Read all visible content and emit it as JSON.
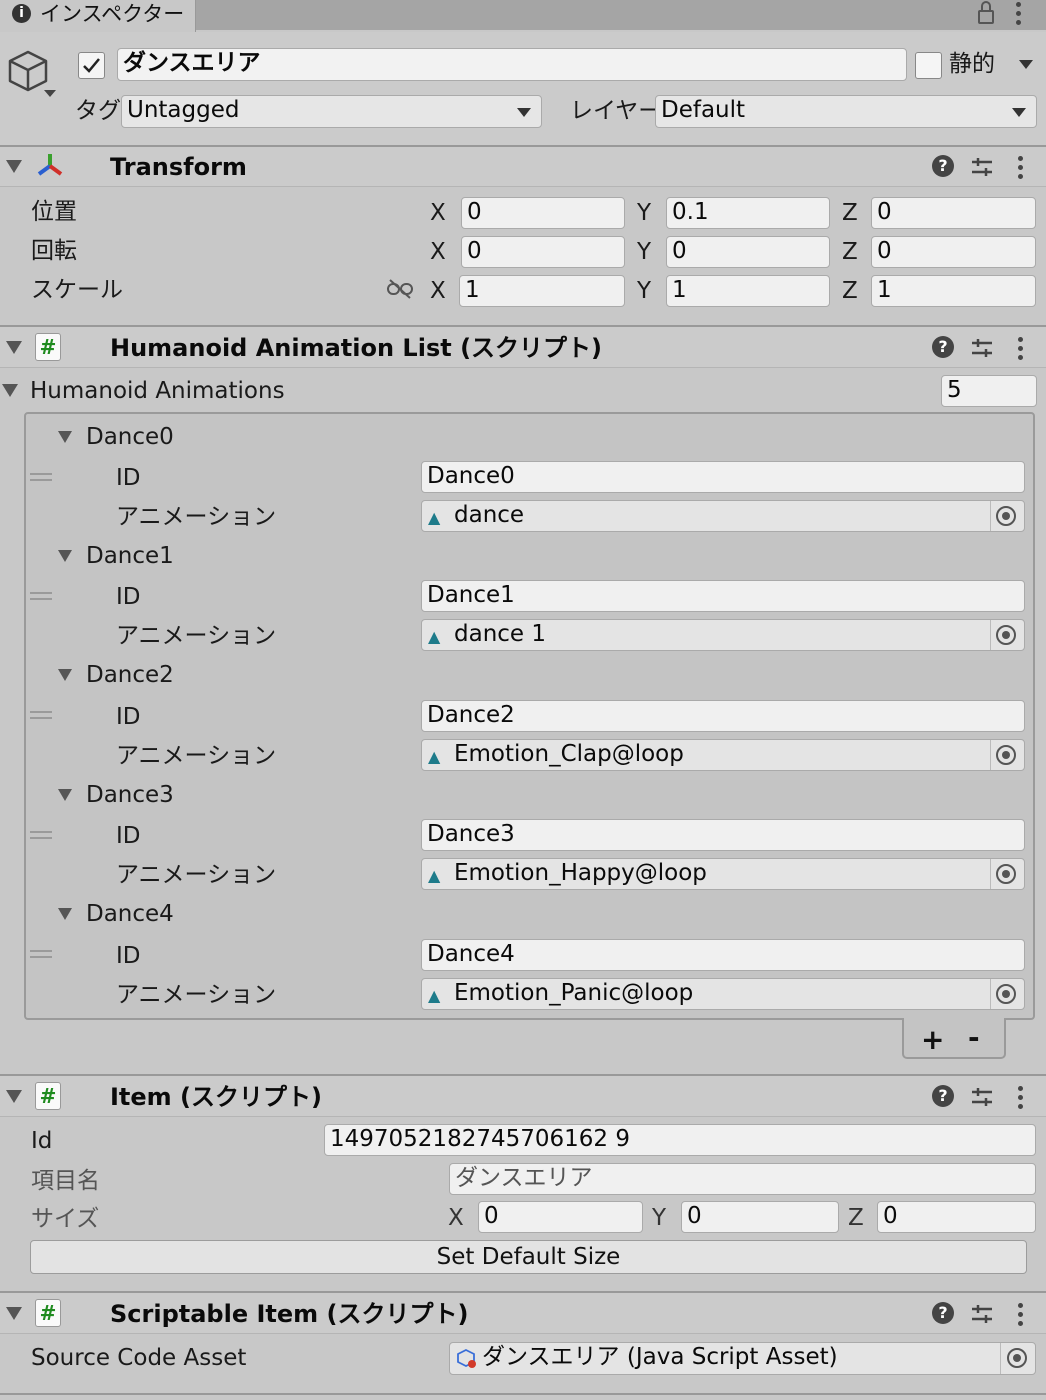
{
  "tab": {
    "title": "インスペクター"
  },
  "gameobject": {
    "name": "ダンスエリア",
    "active": true,
    "static_label": "静的",
    "tag_label": "タグ",
    "tag_value": "Untagged",
    "layer_label": "レイヤー",
    "layer_value": "Default"
  },
  "transform": {
    "title": "Transform",
    "rows": [
      {
        "label": "位置",
        "x": "0",
        "y": "0.1",
        "z": "0"
      },
      {
        "label": "回転",
        "x": "0",
        "y": "0",
        "z": "0"
      },
      {
        "label": "スケール",
        "x": "1",
        "y": "1",
        "z": "1"
      }
    ],
    "axis_x": "X",
    "axis_y": "Y",
    "axis_z": "Z"
  },
  "humanoid": {
    "title": "Humanoid Animation List (スクリプト)",
    "list_label": "Humanoid Animations",
    "count": "5",
    "id_label": "ID",
    "anim_label": "アニメーション",
    "items": [
      {
        "name": "Dance0",
        "id": "Dance0",
        "anim": "dance"
      },
      {
        "name": "Dance1",
        "id": "Dance1",
        "anim": "dance 1"
      },
      {
        "name": "Dance2",
        "id": "Dance2",
        "anim": "Emotion_Clap@loop"
      },
      {
        "name": "Dance3",
        "id": "Dance3",
        "anim": "Emotion_Happy@loop"
      },
      {
        "name": "Dance4",
        "id": "Dance4",
        "anim": "Emotion_Panic@loop"
      }
    ],
    "add_label": "+",
    "remove_label": "-"
  },
  "item": {
    "title": "Item (スクリプト)",
    "id_label": "Id",
    "id_value": "1497052182745706162 9",
    "name_label": "項目名",
    "name_value": "ダンスエリア",
    "size_label": "サイズ",
    "size_x": "0",
    "size_y": "0",
    "size_z": "0",
    "button_label": "Set Default Size"
  },
  "scriptable": {
    "title": "Scriptable Item (スクリプト)",
    "source_label": "Source Code Asset",
    "source_value": "ダンスエリア (Java Script Asset)"
  },
  "icons": [
    "info-icon",
    "lock-icon",
    "kebab-menu-icon",
    "gameobject-cube-icon",
    "checkbox-check-icon",
    "dropdown-arrow-icon",
    "transform-axes-icon",
    "help-icon",
    "preset-sliders-icon",
    "constrain-proportions-icon",
    "script-hash-icon",
    "animation-clip-icon",
    "object-picker-icon",
    "drag-handle-icon",
    "foldout-triangle-icon"
  ]
}
